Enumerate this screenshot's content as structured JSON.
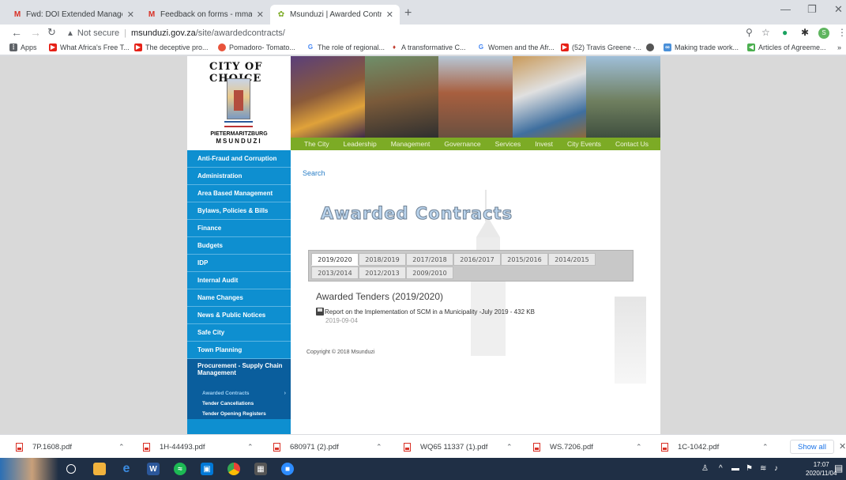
{
  "browser": {
    "tabs": [
      {
        "title": "Fwd: DOI Extended Managemen",
        "icon": "gmail-icon"
      },
      {
        "title": "Feedback on forms - mmaziwis",
        "icon": "gmail-icon"
      },
      {
        "title": "Msunduzi | Awarded Contracts",
        "icon": "site-icon"
      }
    ],
    "address": {
      "security": "Not secure",
      "host": "msunduzi.gov.za",
      "path": "/site/awardedcontracts/"
    },
    "bookmarks": [
      {
        "label": "Apps",
        "icon": "apps-grid-icon",
        "color": "#5f6368"
      },
      {
        "label": "What Africa's Free T...",
        "icon": "youtube-icon",
        "color": "#e62117"
      },
      {
        "label": "The deceptive pro...",
        "icon": "youtube-icon",
        "color": "#e62117"
      },
      {
        "label": "Pomadoro- Tomato...",
        "icon": "tomato-icon",
        "color": "#e8533b"
      },
      {
        "label": "The role of regional...",
        "icon": "google-icon",
        "color": "#4285f4"
      },
      {
        "label": "A transformative C...",
        "icon": "figure-icon",
        "color": "#c0392b"
      },
      {
        "label": "Women and the Afr...",
        "icon": "google-icon",
        "color": "#4285f4"
      },
      {
        "label": "(52) Travis Greene -...",
        "icon": "youtube-icon",
        "color": "#e62117"
      },
      {
        "label": "Making trade work...",
        "icon": "globe-icon",
        "color": "#4a90d9"
      },
      {
        "label": "Articles of Agreeme...",
        "icon": "leaf-icon",
        "color": "#4caf50"
      }
    ]
  },
  "site": {
    "logo": {
      "arc_text": "CITY OF CHOICE",
      "city": "PIETERMARITZBURG",
      "name": "MSUNDUZI"
    },
    "nav": [
      "The City",
      "Leadership",
      "Management",
      "Governance",
      "Services",
      "Invest",
      "City Events",
      "Contact Us"
    ],
    "sidebar": [
      "Anti-Fraud and Corruption",
      "Administration",
      "Area Based Management",
      "Bylaws, Policies & Bills",
      "Finance",
      "Budgets",
      "IDP",
      "Internal Audit",
      "Name Changes",
      "News & Public Notices",
      "Safe City",
      "Town Planning"
    ],
    "sidebar_active": "Procurement - Supply Chain Management",
    "sidebar_sub": [
      "Awarded Contracts",
      "Tender Cancellations",
      "Tender Opening Registers"
    ],
    "search_label": "Search",
    "page_title": "Awarded Contracts",
    "year_tabs_row1": [
      "2019/2020",
      "2018/2019",
      "2017/2018",
      "2016/2017",
      "2015/2016",
      "2014/2015"
    ],
    "year_tabs_row2": [
      "2013/2014",
      "2012/2013",
      "2009/2010"
    ],
    "tender_heading": "Awarded Tenders (2019/2020)",
    "document": {
      "title": "Report on the Implementation of SCM in a Municipality -July 2019",
      "size": " - 432 KB",
      "date": "2019-09-04"
    },
    "copyright": "Copyright © 2018 Msunduzi"
  },
  "downloads": [
    "7P.1608.pdf",
    "1H-44493.pdf",
    "680971 (2).pdf",
    "WQ65 11337 (1).pdf",
    "WS.7206.pdf",
    "1C-1042.pdf"
  ],
  "downloads_show_all": "Show all",
  "taskbar": {
    "time": "17:07",
    "date": "2020/11/04"
  },
  "colors": {
    "nav_green": "#7cab25",
    "sidebar_blue": "#0e8fd0",
    "sidebar_active": "#0a5e9d",
    "link": "#2a7fc7"
  }
}
